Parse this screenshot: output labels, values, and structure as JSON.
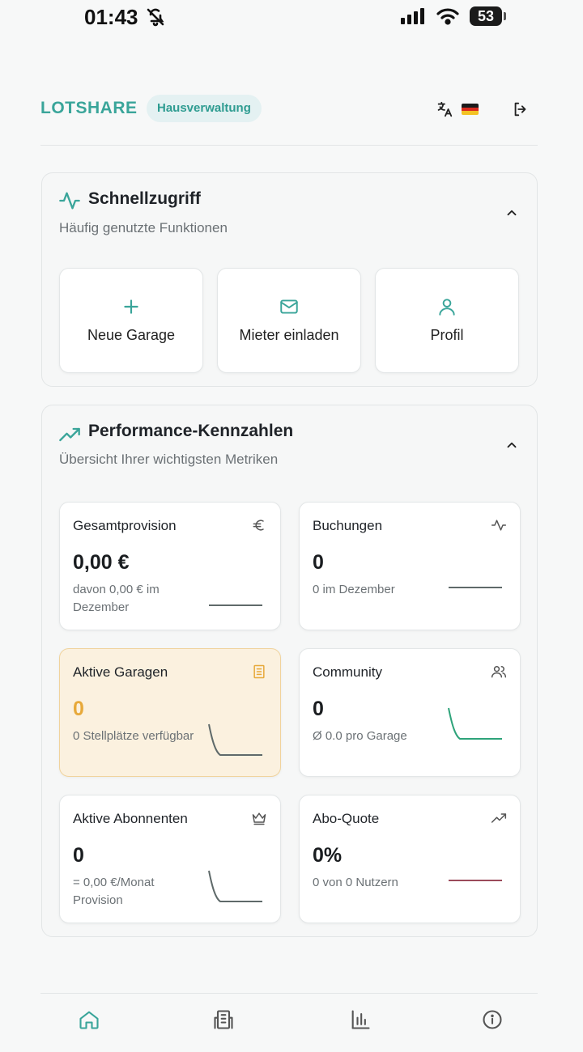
{
  "status_bar": {
    "time": "01:43",
    "battery": "53",
    "icons": [
      "bell-off-icon",
      "signal-icon",
      "wifi-icon",
      "battery-icon"
    ]
  },
  "header": {
    "brand": "LOTSHARE",
    "role_badge": "Hausverwaltung",
    "icons": [
      "translate-icon",
      "flag-de-icon",
      "logout-icon"
    ]
  },
  "quick_access": {
    "title": "Schnellzugriff",
    "subtitle": "Häufig genutzte Funktionen",
    "icon": "activity-icon",
    "items": [
      {
        "label": "Neue Garage",
        "icon": "plus-icon"
      },
      {
        "label": "Mieter einladen",
        "icon": "mail-icon"
      },
      {
        "label": "Profil",
        "icon": "user-icon"
      }
    ]
  },
  "performance": {
    "title": "Performance-Kennzahlen",
    "subtitle": "Übersicht Ihrer wichtigsten Metriken",
    "icon": "trending-up-icon",
    "metrics": [
      {
        "title": "Gesamtprovision",
        "value": "0,00 €",
        "note": "davon 0,00 € im Dezember",
        "icon": "euro-icon",
        "spark_color": "#5f6a6a"
      },
      {
        "title": "Buchungen",
        "value": "0",
        "note": "0 im Dezember",
        "icon": "activity-icon",
        "spark_color": "#5f6a6a"
      },
      {
        "title": "Aktive Garagen",
        "value": "0",
        "note": "0 Stellplätze verfügbar",
        "icon": "building-icon",
        "spark_color": "#5f6a6a"
      },
      {
        "title": "Community",
        "value": "0",
        "note": "Ø 0.0 pro Garage",
        "icon": "users-icon",
        "spark_color": "#2ea37a"
      },
      {
        "title": "Aktive Abonnenten",
        "value": "0",
        "note": "= 0,00 €/Monat Provision",
        "icon": "crown-icon",
        "spark_color": "#5f6a6a"
      },
      {
        "title": "Abo-Quote",
        "value": "0%",
        "note": "0 von 0 Nutzern",
        "icon": "trending-up-icon",
        "spark_color": "#9b4a5a"
      }
    ]
  },
  "bottom_nav": {
    "items": [
      "home-icon",
      "building-icon",
      "bar-chart-icon",
      "info-icon"
    ],
    "active_color": "#3aa59a"
  }
}
